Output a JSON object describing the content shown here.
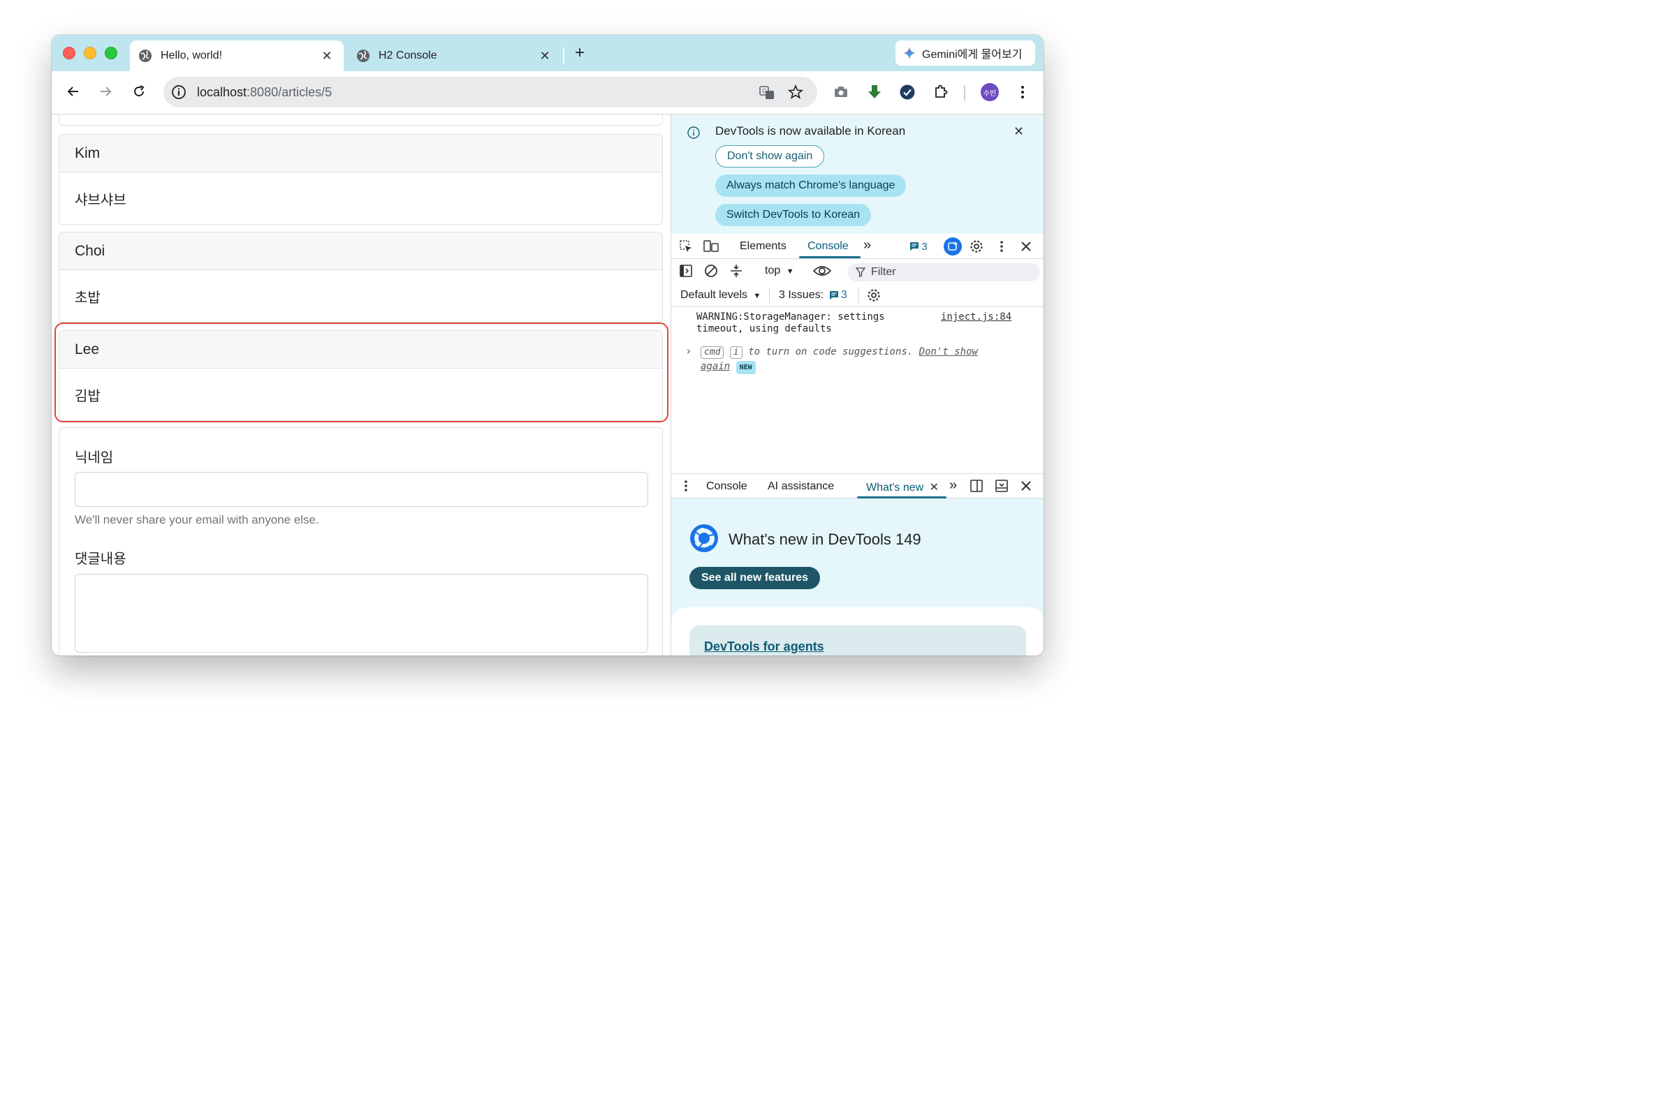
{
  "browser": {
    "tabs": [
      {
        "title": "Hello, world!",
        "close": "✕"
      },
      {
        "title": "H2 Console",
        "close": "✕"
      }
    ],
    "new_tab": "+",
    "gemini_label": "Gemini에게 물어보기",
    "url_host": "localhost",
    "url_rest": ":8080/articles/5",
    "avatar_text": "수빈"
  },
  "comments": [
    {
      "nickname": "Kim",
      "body": "샤브샤브"
    },
    {
      "nickname": "Choi",
      "body": "초밥"
    },
    {
      "nickname": "Lee",
      "body": "김밥"
    }
  ],
  "comment_form": {
    "nickname_label": "닉네임",
    "nickname_value": "",
    "help_text": "We'll never share your email with anyone else.",
    "body_label": "댓글내용",
    "body_value": ""
  },
  "devtools": {
    "banner": {
      "text": "DevTools is now available in Korean",
      "close": "✕",
      "dont_show": "Don't show again",
      "match_language": "Always match Chrome's language",
      "switch_korean": "Switch DevTools to Korean"
    },
    "tabs": {
      "elements": "Elements",
      "console": "Console",
      "more": "»",
      "message_count": "3"
    },
    "console_toolbar": {
      "context": "top",
      "filter_placeholder": "Filter",
      "levels": "Default levels",
      "issues_label": "3 Issues:",
      "issues_count": "3"
    },
    "messages": {
      "warning_line1": "WARNING:StorageManager: settings",
      "warning_line2": "timeout, using defaults",
      "warning_source": "inject.js:84",
      "prompt_arrow": "›",
      "kbd_cmd": "cmd",
      "kbd_i": "i",
      "hint_text": "to turn on code suggestions.",
      "hint_link_1": "Don't show",
      "hint_link_2": "again",
      "new_badge": "NEW"
    },
    "drawer": {
      "tabs": {
        "console": "Console",
        "ai": "AI assistance",
        "whats_new": "What's new",
        "more": "»"
      },
      "title": "What's new in DevTools 149",
      "button": "See all new features",
      "card_link": "DevTools for agents"
    }
  },
  "colors": {
    "titlebar": "#bfe6ef",
    "highlight_border": "#e0443e",
    "devtools_accent": "#1a6e8a",
    "banner_bg": "#e6f7fb"
  }
}
